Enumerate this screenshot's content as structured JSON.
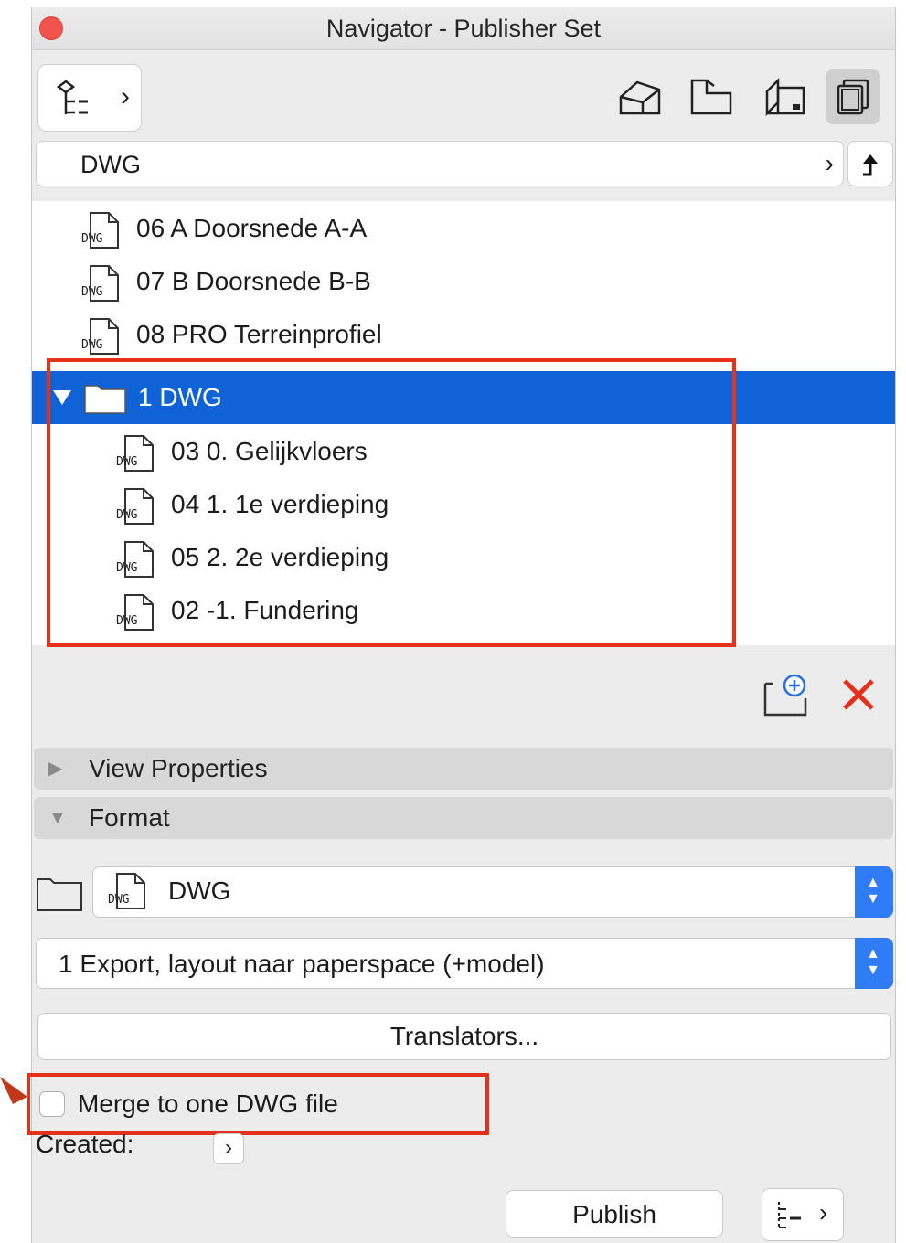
{
  "window": {
    "title": "Navigator - Publisher Set"
  },
  "toolbar": {
    "map_chevron": "›",
    "tabs": [
      {
        "icon": "project-map-icon"
      },
      {
        "icon": "view-map-icon"
      },
      {
        "icon": "layout-book-icon"
      },
      {
        "icon": "publisher-sets-icon",
        "active": true
      }
    ]
  },
  "path": {
    "label": "DWG",
    "chevron": "›"
  },
  "tree": {
    "items": [
      {
        "type": "file",
        "badge": "DWG",
        "label": "06 A Doorsnede A-A"
      },
      {
        "type": "file",
        "badge": "DWG",
        "label": "07 B Doorsnede B-B"
      },
      {
        "type": "file",
        "badge": "DWG",
        "label": "08 PRO Terreinprofiel"
      },
      {
        "type": "folder",
        "label": "1 DWG",
        "expanded": true,
        "selected": true
      },
      {
        "type": "file",
        "badge": "DWG",
        "label": "03 0. Gelijkvloers"
      },
      {
        "type": "file",
        "badge": "DWG",
        "label": "04 1. 1e verdieping"
      },
      {
        "type": "file",
        "badge": "DWG",
        "label": "05 2. 2e verdieping"
      },
      {
        "type": "file",
        "badge": "DWG",
        "label": "02 -1. Fundering"
      }
    ]
  },
  "sections": {
    "view_properties": "View Properties",
    "format": "Format"
  },
  "format": {
    "type_badge": "DWG",
    "type_value": "DWG",
    "translator_value": "1 Export, layout naar paperspace (+model)",
    "translators_button": "Translators...",
    "merge_label": "Merge to one DWG file",
    "merge_checked": false,
    "created_label": "Created:",
    "created_chevron": "›"
  },
  "footer": {
    "publish_button": "Publish",
    "more_chevron": "›"
  },
  "colors": {
    "selection": "#0f63d6",
    "highlight": "#e5301a",
    "delete": "#e5301a",
    "popup_arrows": "#2f7cf6"
  }
}
